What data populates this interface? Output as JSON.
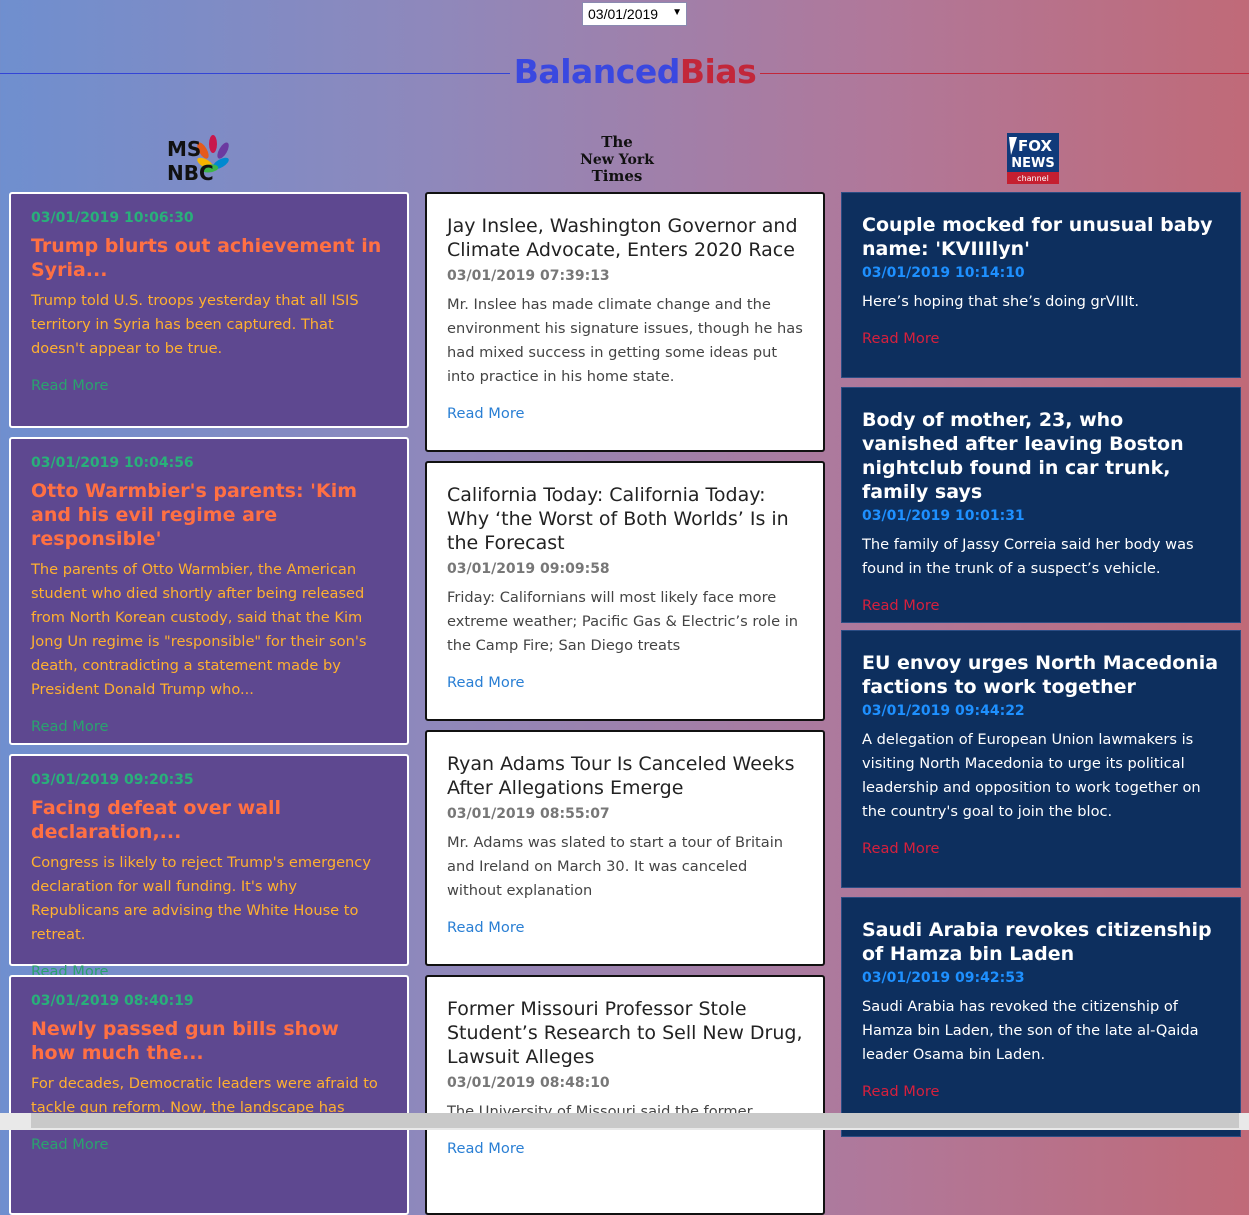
{
  "date_picker": {
    "value": "03/01/2019"
  },
  "brand": {
    "part1": "Balanced",
    "part2": "Bias"
  },
  "logos": {
    "msnbc": {
      "line1": "MS",
      "line2": "NBC"
    },
    "nyt": {
      "line1": "The",
      "line2": "New York",
      "line3": "Times"
    },
    "fox": {
      "line1": "FOX",
      "line2": "NEWS",
      "line3": "channel"
    }
  },
  "msnbc": [
    {
      "ts": "03/01/2019 10:06:30",
      "title": "Trump blurts out achievement in Syria...",
      "desc": "Trump told U.S. troops yesterday that all ISIS territory in Syria has been captured. That doesn't appear to be true.",
      "more": "Read More"
    },
    {
      "ts": "03/01/2019 10:04:56",
      "title": "Otto Warmbier's parents: 'Kim and his evil regime are responsible'",
      "desc": "The parents of Otto Warmbier, the American student who died shortly after being released from North Korean custody, said that the Kim Jong Un regime is \"responsible\" for their son's death, contradicting a statement made by President Donald Trump who...",
      "more": "Read More"
    },
    {
      "ts": "03/01/2019 09:20:35",
      "title": "Facing defeat over wall declaration,...",
      "desc": "Congress is likely to reject Trump's emergency declaration for wall funding. It's why Republicans are advising the White House to retreat.",
      "more": "Read More"
    },
    {
      "ts": "03/01/2019 08:40:19",
      "title": "Newly passed gun bills show how much the...",
      "desc": "For decades, Democratic leaders were afraid to tackle gun reform. Now, the landscape has",
      "more": "Read More"
    }
  ],
  "nyt": [
    {
      "title": "Jay Inslee, Washington Governor and Climate Advocate, Enters 2020 Race",
      "ts": "03/01/2019 07:39:13",
      "desc": "Mr. Inslee has made climate change and the environment his signature issues, though he has had mixed success in getting some ideas put into practice in his home state.",
      "more": "Read More"
    },
    {
      "title": "California Today: California Today: Why ‘the Worst of Both Worlds’ Is in the Forecast",
      "ts": "03/01/2019 09:09:58",
      "desc": "Friday: Californians will most likely face more extreme weather; Pacific Gas & Electric’s role in the Camp Fire; San Diego treats",
      "more": "Read More"
    },
    {
      "title": "Ryan Adams Tour Is Canceled Weeks After Allegations Emerge",
      "ts": "03/01/2019 08:55:07",
      "desc": "Mr. Adams was slated to start a tour of Britain and Ireland on March 30. It was canceled without explanation",
      "more": "Read More"
    },
    {
      "title": "Former Missouri Professor Stole Student’s Research to Sell New Drug, Lawsuit Alleges",
      "ts": "03/01/2019 08:48:10",
      "desc": "The University of Missouri said the former",
      "more": "Read More"
    }
  ],
  "fox": [
    {
      "title": "Couple mocked for unusual baby name: 'KVIIIlyn'",
      "ts": "03/01/2019 10:14:10",
      "desc": "Here’s hoping that she’s doing grVIIIt.",
      "more": "Read More"
    },
    {
      "title": "Body of mother, 23, who vanished after leaving Boston nightclub found in car trunk, family says",
      "ts": "03/01/2019 10:01:31",
      "desc": "The family of Jassy Correia said her body was found in the trunk of a suspect’s vehicle.",
      "more": "Read More"
    },
    {
      "title": "EU envoy urges North Macedonia factions to work together",
      "ts": "03/01/2019 09:44:22",
      "desc": "A delegation of European Union lawmakers is visiting North Macedonia to urge its political leadership and opposition to work together on the country's goal to join the bloc.",
      "more": "Read More"
    },
    {
      "title": "Saudi Arabia revokes citizenship of Hamza bin Laden",
      "ts": "03/01/2019 09:42:53",
      "desc": "Saudi Arabia has revoked the citizenship of Hamza bin Laden, the son of the late al-Qaida leader Osama bin Laden.",
      "more": "Read More"
    }
  ]
}
